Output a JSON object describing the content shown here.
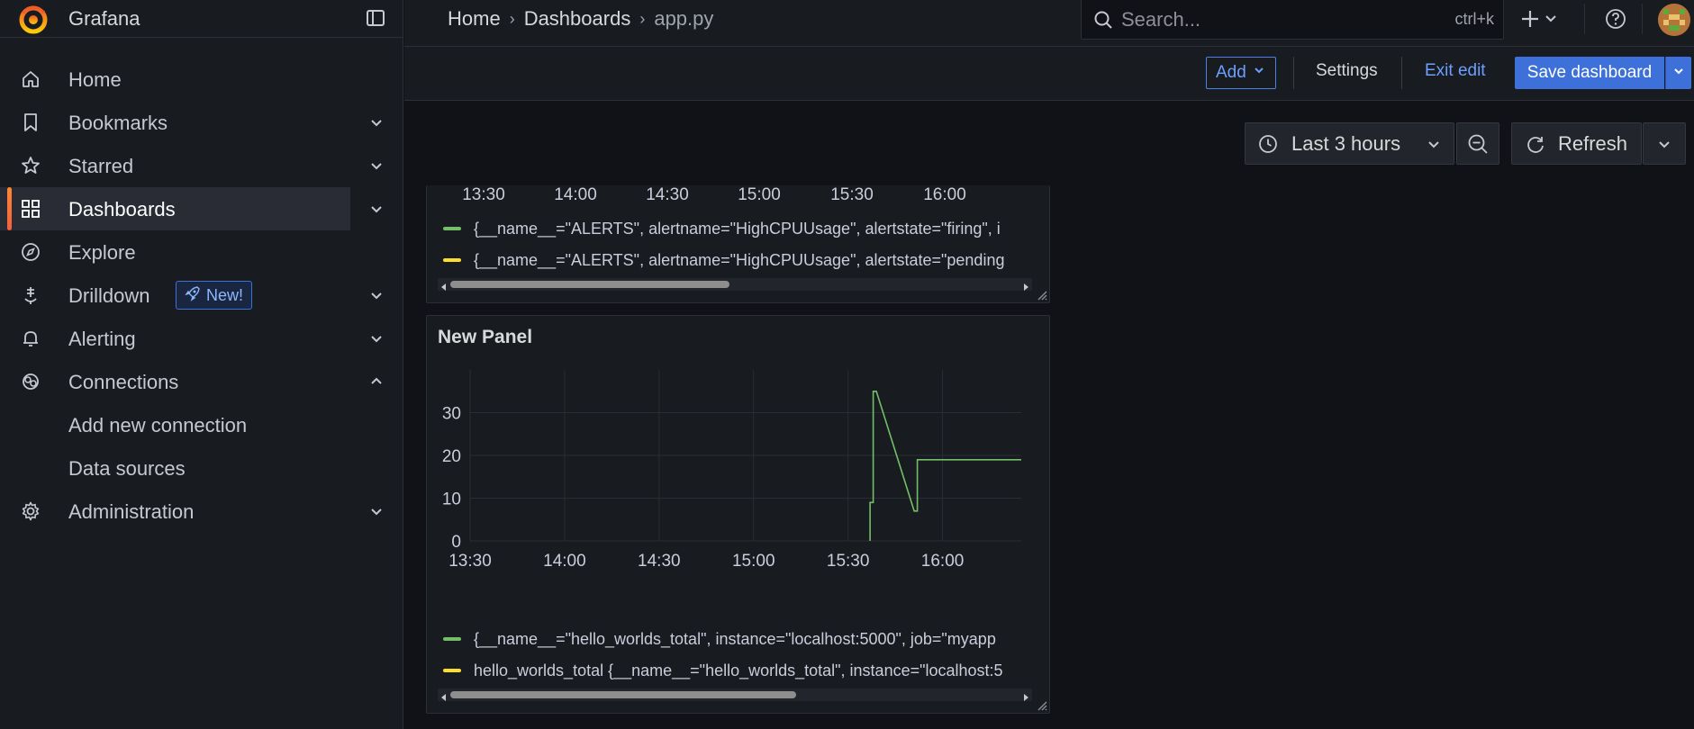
{
  "app": {
    "name": "Grafana"
  },
  "colors": {
    "accent": "#3d71d9",
    "series_green": "#73bf69",
    "series_yellow": "#fade2a",
    "active_bar": "#f55f3e"
  },
  "sidebar": {
    "items": [
      {
        "label": "Home",
        "icon": "home-icon"
      },
      {
        "label": "Bookmarks",
        "icon": "bookmark-icon"
      },
      {
        "label": "Starred",
        "icon": "star-icon"
      },
      {
        "label": "Dashboards",
        "icon": "apps-icon",
        "active": true
      },
      {
        "label": "Explore",
        "icon": "compass-icon"
      },
      {
        "label": "Drilldown",
        "icon": "drilldown-icon",
        "badge": "New!"
      },
      {
        "label": "Alerting",
        "icon": "bell-icon"
      },
      {
        "label": "Connections",
        "icon": "connections-icon",
        "expanded": true
      },
      {
        "label": "Add new connection"
      },
      {
        "label": "Data sources"
      },
      {
        "label": "Administration",
        "icon": "cog-icon"
      }
    ]
  },
  "breadcrumb": {
    "home": "Home",
    "section": "Dashboards",
    "current": "app.py"
  },
  "search": {
    "placeholder": "Search...",
    "shortcut": "ctrl+k"
  },
  "toolbar": {
    "add_label": "Add",
    "settings_label": "Settings",
    "exit_label": "Exit edit",
    "save_label": "Save dashboard"
  },
  "time": {
    "range_label": "Last 3 hours",
    "refresh_label": "Refresh"
  },
  "panel_a": {
    "x_ticks": [
      "13:30",
      "14:00",
      "14:30",
      "15:00",
      "15:30",
      "16:00"
    ],
    "legend": [
      "{__name__=\"ALERTS\", alertname=\"HighCPUUsage\", alertstate=\"firing\", i",
      "{__name__=\"ALERTS\", alertname=\"HighCPUUsage\", alertstate=\"pending"
    ],
    "scroll_fraction": 0.5
  },
  "panel_b": {
    "title": "New Panel",
    "x_ticks": [
      "13:30",
      "14:00",
      "14:30",
      "15:00",
      "15:30",
      "16:00"
    ],
    "y_ticks": [
      "0",
      "10",
      "20",
      "30"
    ],
    "legend": [
      "{__name__=\"hello_worlds_total\", instance=\"localhost:5000\", job=\"myapp",
      "hello_worlds_total {__name__=\"hello_worlds_total\", instance=\"localhost:5"
    ],
    "scroll_fraction": 0.62
  },
  "chart_data": {
    "type": "line",
    "title": "New Panel",
    "xlabel": "",
    "ylabel": "",
    "ylim": [
      0,
      40
    ],
    "xlim": [
      "13:30",
      "16:25"
    ],
    "grid": true,
    "legend_placement": "bottom",
    "series": [
      {
        "name": "{__name__=\"hello_worlds_total\", instance=\"localhost:5000\", job=\"myapp",
        "color": "#73bf69",
        "points": [
          [
            "15:37",
            0
          ],
          [
            "15:37",
            9
          ],
          [
            "15:38",
            9
          ],
          [
            "15:38",
            35
          ],
          [
            "15:39",
            35
          ],
          [
            "15:51",
            7
          ],
          [
            "15:52",
            7
          ],
          [
            "15:52",
            19
          ],
          [
            "16:25",
            19
          ]
        ]
      }
    ]
  }
}
